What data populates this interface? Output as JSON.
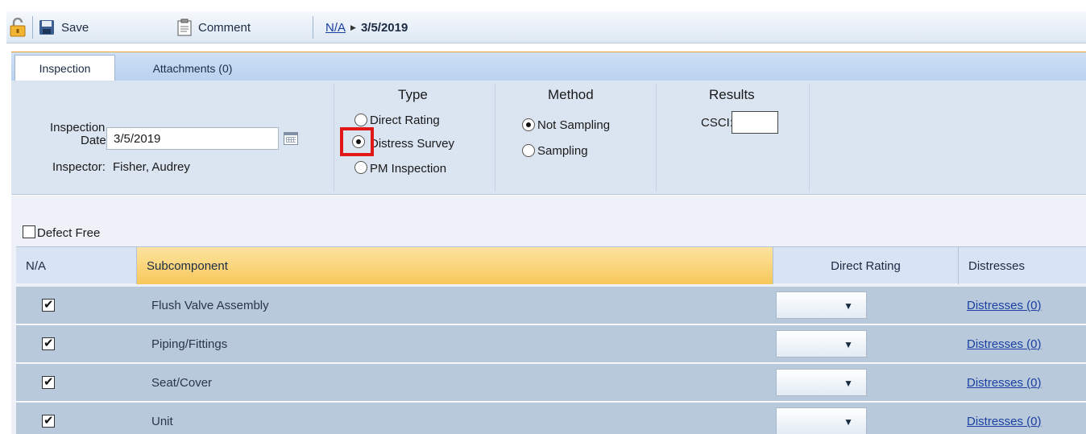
{
  "toolbar": {
    "save_label": "Save",
    "comment_label": "Comment",
    "breadcrumb_link": "N/A",
    "breadcrumb_date": "3/5/2019"
  },
  "tabs": [
    {
      "label": "Inspection",
      "active": true
    },
    {
      "label": "Attachments (0)",
      "active": false
    }
  ],
  "inspection": {
    "date_label_line1": "Inspection",
    "date_label_line2": "Date:",
    "date_value": "3/5/2019",
    "inspector_label": "Inspector:",
    "inspector_name": "Fisher, Audrey"
  },
  "type": {
    "heading": "Type",
    "options": [
      "Direct Rating",
      "Distress Survey",
      "PM Inspection"
    ],
    "selected": "Distress Survey"
  },
  "method": {
    "heading": "Method",
    "options": [
      "Not Sampling",
      "Sampling"
    ],
    "selected": "Not Sampling"
  },
  "results": {
    "heading": "Results",
    "csci_label": "CSCI:",
    "csci_value": ""
  },
  "defect_free": {
    "label": "Defect Free",
    "checked": false
  },
  "grid": {
    "columns": [
      "N/A",
      "Subcomponent",
      "Direct Rating",
      "Distresses"
    ],
    "rows": [
      {
        "na": true,
        "subcomponent": "Flush Valve Assembly",
        "direct_rating": "",
        "distresses": "Distresses (0)"
      },
      {
        "na": true,
        "subcomponent": "Piping/Fittings",
        "direct_rating": "",
        "distresses": "Distresses (0)"
      },
      {
        "na": true,
        "subcomponent": "Seat/Cover",
        "direct_rating": "",
        "distresses": "Distresses (0)"
      },
      {
        "na": true,
        "subcomponent": "Unit",
        "direct_rating": "",
        "distresses": "Distresses (0)"
      }
    ]
  },
  "colors": {
    "accent_tab_border": "#e8a02a",
    "subcomponent_header": "#f7c85a",
    "row_bg": "#b9c9dc",
    "highlight": "#e01818",
    "link": "#1a3fa0"
  },
  "icons": [
    "lock-icon",
    "save-icon",
    "comment-icon",
    "calendar-icon",
    "dropdown-caret-icon"
  ]
}
